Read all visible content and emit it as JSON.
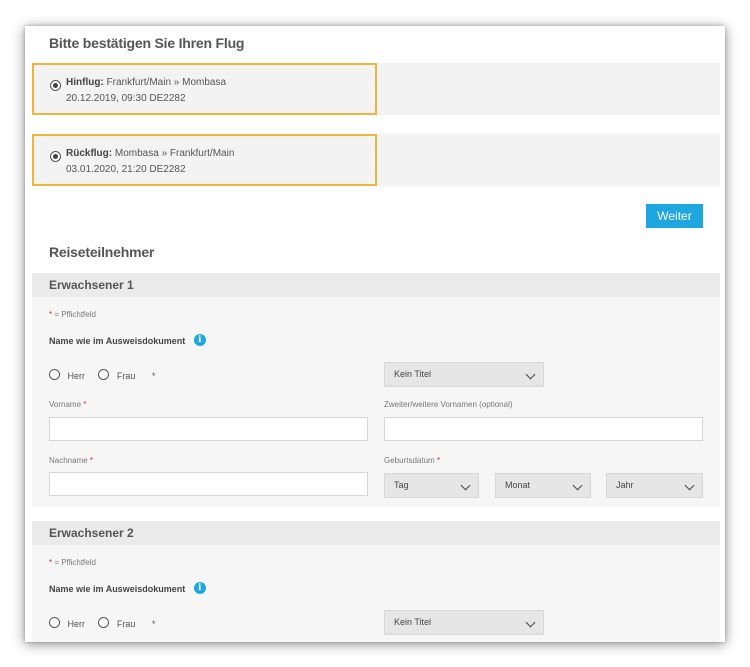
{
  "confirm": {
    "title": "Bitte bestätigen Sie Ihren Flug",
    "outbound": {
      "label": "Hinflug:",
      "route": "Frankfurt/Main » Mombasa",
      "details": "20.12.2019, 09:30 DE2282"
    },
    "return": {
      "label": "Rückflug:",
      "route": "Mombasa » Frankfurt/Main",
      "details": "03.01.2020, 21:20 DE2282"
    },
    "accent_color": "#f0b43c"
  },
  "continue_label": "Weiter",
  "participants": {
    "title": "Reiseteilnehmer",
    "adults": [
      {
        "heading": "Erwachsener 1",
        "required_marker": "*",
        "required_note": "= Pflichtfeld",
        "name_label": "Name wie im Ausweisdokument",
        "info_icon": "i",
        "salutation_mr": "Herr",
        "salutation_mrs": "Frau",
        "title_select": "Kein Titel",
        "firstname_label": "Vorname",
        "middlename_label": "Zweiter/weitere Vornamen (optional)",
        "lastname_label": "Nachname",
        "birthdate_label": "Geburtsdatum",
        "day": "Tag",
        "month": "Monat",
        "year": "Jahr"
      },
      {
        "heading": "Erwachsener 2",
        "required_marker": "*",
        "required_note": "= Pflichtfeld",
        "name_label": "Name wie im Ausweisdokument",
        "info_icon": "i",
        "salutation_mr": "Herr",
        "salutation_mrs": "Frau",
        "title_select": "Kein Titel"
      }
    ]
  },
  "button_color": "#1ea6e0"
}
